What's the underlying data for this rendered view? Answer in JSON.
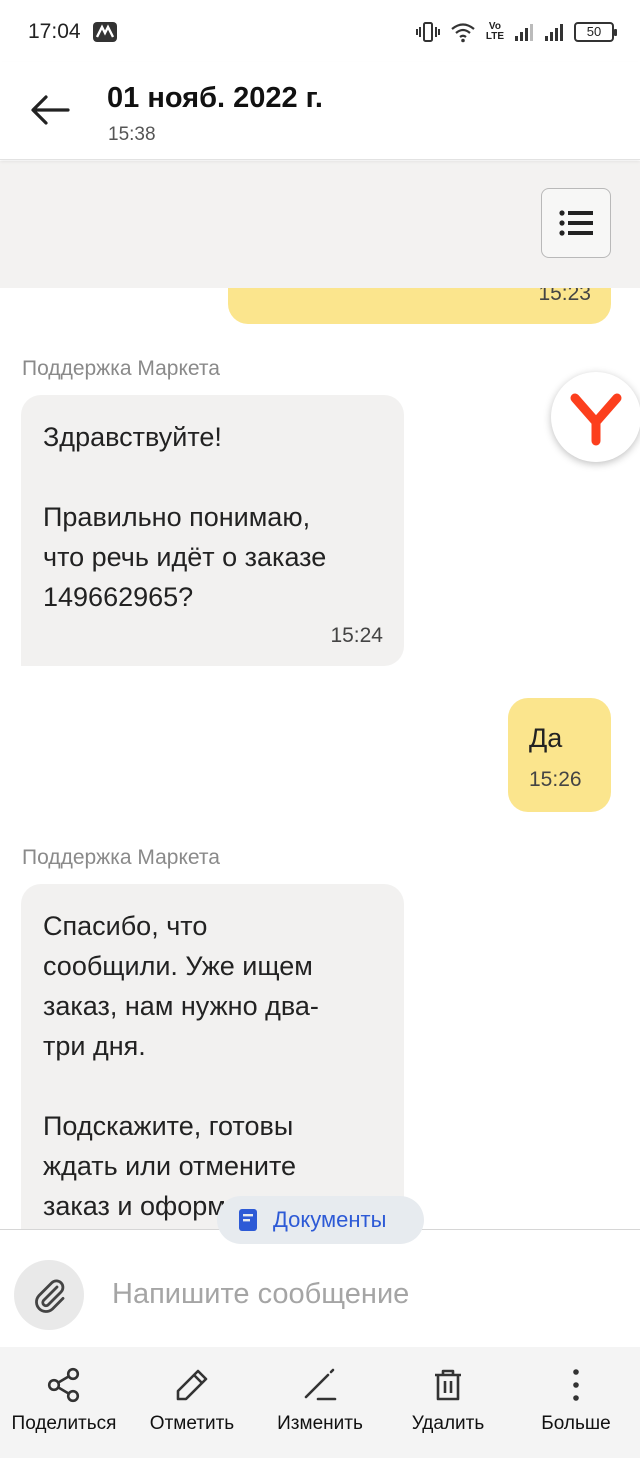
{
  "status_bar": {
    "time": "17:04",
    "volte_top": "Vo",
    "volte_bottom": "LTE",
    "battery": "50"
  },
  "header": {
    "title": "01 нояб. 2022 г.",
    "subtitle": "15:38"
  },
  "messages": [
    {
      "direction": "outgoing",
      "text": "",
      "time": "15:23"
    },
    {
      "direction": "incoming",
      "sender": "Поддержка Маркета",
      "text": "Здравствуйте!\n\nПравильно понимаю,\nчто речь идёт о заказе\n149662965?",
      "time": "15:24"
    },
    {
      "direction": "outgoing",
      "text": "Да",
      "time": "15:26"
    },
    {
      "direction": "incoming",
      "sender": "Поддержка Маркета",
      "text": "Спасибо, что\nсообщили. Уже ищем\nзаказ, нам нужно два-\nтри дня.\n\nПодскажите, готовы\nждать или отмените\nзаказ и оформите\nновый?",
      "time": ""
    }
  ],
  "documents_chip": {
    "label": "Документы"
  },
  "composer": {
    "placeholder": "Напишите сообщение",
    "value": ""
  },
  "actions": [
    {
      "id": "share",
      "label": "Поделиться",
      "icon": "share-icon"
    },
    {
      "id": "mark",
      "label": "Отметить",
      "icon": "pencil-icon"
    },
    {
      "id": "edit",
      "label": "Изменить",
      "icon": "edit-line-icon"
    },
    {
      "id": "delete",
      "label": "Удалить",
      "icon": "trash-icon"
    },
    {
      "id": "more",
      "label": "Больше",
      "icon": "more-vertical-icon"
    }
  ],
  "colors": {
    "outgoing_bubble": "#fbe58d",
    "incoming_bubble": "#f2f1f0",
    "accent_blue": "#2d5ad6",
    "yandex_red": "#fc3f1d"
  }
}
